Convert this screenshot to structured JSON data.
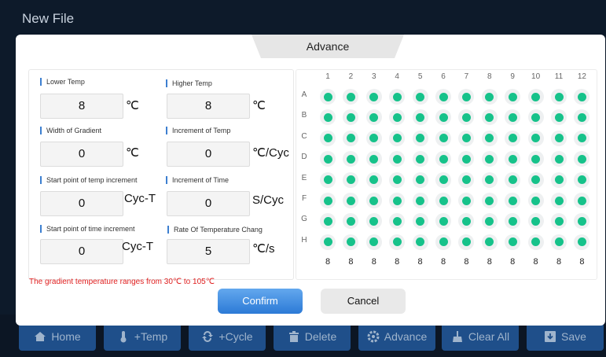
{
  "window": {
    "title": "New File"
  },
  "dialog": {
    "title": "Advance",
    "fields": {
      "lower_temp": {
        "label": "Lower Temp",
        "value": "8",
        "unit": "℃"
      },
      "higher_temp": {
        "label": "Higher Temp",
        "value": "8",
        "unit": "℃"
      },
      "width_of_gradient": {
        "label": "Width of Gradient",
        "value": "0",
        "unit": "℃"
      },
      "increment_of_temp": {
        "label": "Increment of Temp",
        "value": "0",
        "unit": "℃/Cyc"
      },
      "start_point_temp_increment": {
        "label": "Start point of temp increment",
        "value": "0",
        "unit": "Cyc-T"
      },
      "increment_of_time": {
        "label": "Increment of Time",
        "value": "0",
        "unit": "S/Cyc"
      },
      "start_point_time_increment": {
        "label": "Start point of time increment",
        "value": "0",
        "unit": "Cyc-T"
      },
      "rate_of_temp_change": {
        "label": "Rate Of Temperature Chang",
        "value": "5",
        "unit": "℃/s"
      }
    },
    "note": "The gradient temperature ranges from 30℃ to 105℃",
    "confirm_label": "Confirm",
    "cancel_label": "Cancel"
  },
  "plate": {
    "columns": [
      "1",
      "2",
      "3",
      "4",
      "5",
      "6",
      "7",
      "8",
      "9",
      "10",
      "11",
      "12"
    ],
    "rows": [
      "A",
      "B",
      "C",
      "D",
      "E",
      "F",
      "G",
      "H"
    ],
    "column_counts": [
      "8",
      "8",
      "8",
      "8",
      "8",
      "8",
      "8",
      "8",
      "8",
      "8",
      "8",
      "8"
    ],
    "well_color": "#16c28a",
    "all_wells_selected": true
  },
  "toolbar": {
    "buttons": [
      {
        "label": "Home",
        "icon": "home-icon"
      },
      {
        "label": "+Temp",
        "icon": "thermometer-icon"
      },
      {
        "label": "+Cycle",
        "icon": "cycle-icon"
      },
      {
        "label": "Delete",
        "icon": "trash-icon"
      },
      {
        "label": "Advance",
        "icon": "gear-icon"
      },
      {
        "label": "Clear All",
        "icon": "broom-icon"
      },
      {
        "label": "Save",
        "icon": "save-icon"
      }
    ]
  }
}
